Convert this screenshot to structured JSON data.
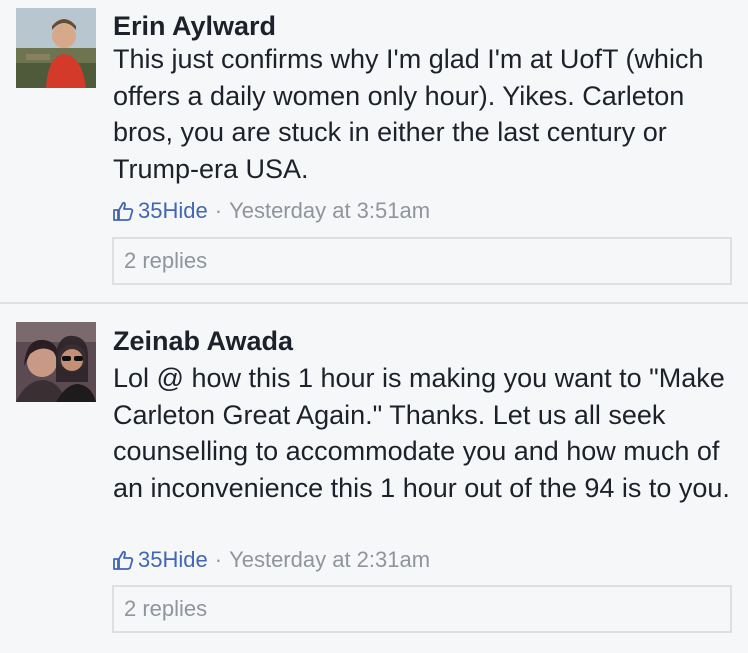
{
  "comments": [
    {
      "author": "Erin Aylward",
      "text": "This just confirms why I'm glad I'm at UofT (which offers a daily women only hour). Yikes. Carleton bros, you are stuck in either the last century or Trump-era USA.",
      "likes": "35",
      "hide_label": "Hide",
      "separator": "·",
      "time": "Yesterday at 3:51am",
      "replies_label": "2 replies"
    },
    {
      "author": "Zeinab Awada",
      "text": "Lol @ how this 1 hour is making you want to \"Make Carleton Great Again.\" Thanks. Let us all seek counselling to accommodate you and how much of an inconvenience this 1 hour out of the 94 is to you.",
      "likes": "35",
      "hide_label": "Hide",
      "separator": "·",
      "time": "Yesterday at 2:31am",
      "replies_label": "2 replies"
    }
  ],
  "colors": {
    "background": "#f6f7f9",
    "link": "#4267b2",
    "meta": "#90949c",
    "text": "#1d2129",
    "border": "#dddfe2"
  },
  "icons": {
    "like": "thumbs-up-icon"
  }
}
